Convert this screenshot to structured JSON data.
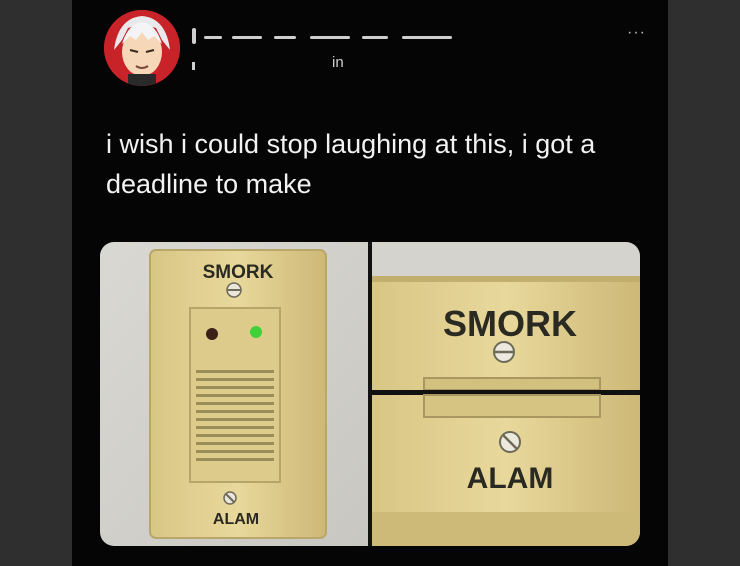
{
  "tweet": {
    "handle_fragment": "in",
    "more_icon": "more-dots-icon",
    "text": "i wish i could stop laughing at this, i got a deadline to make"
  },
  "media": {
    "left_panel": {
      "top_label": "SMORK",
      "bottom_label": "ALAM"
    },
    "top_right_panel": {
      "label": "SMORK"
    },
    "bottom_right_panel": {
      "label": "ALAM"
    },
    "led_color": "#3fd13a"
  }
}
